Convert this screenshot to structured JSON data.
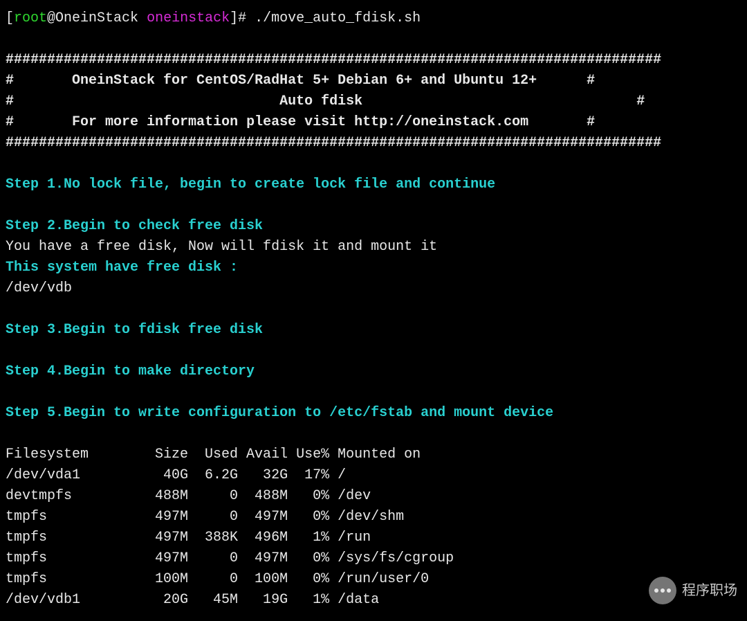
{
  "prompt": {
    "open": "[",
    "user": "root",
    "at": "@OneinStack ",
    "dir": "oneinstack",
    "close": "]# ",
    "command": "./move_auto_fdisk.sh"
  },
  "banner": {
    "hash_line": "###############################################################################",
    "pad": "       ",
    "line1": "OneinStack for CentOS/RadHat 5+ Debian 6+ and Ubuntu 12+",
    "pad1_after": "      ",
    "pad2_before": "                                ",
    "line2": "Auto fdisk",
    "pad2_after": "                                 ",
    "line3": "For more information please visit http://oneinstack.com",
    "pad3_after": "       "
  },
  "steps": {
    "s1": "Step 1.No lock file, begin to create lock file and continue",
    "s2": "Step 2.Begin to check free disk",
    "s2_msg": "You have a free disk, Now will fdisk it and mount it",
    "s2_info": "This system have free disk :",
    "s2_dev": "/dev/vdb",
    "s3": "Step 3.Begin to fdisk free disk",
    "s4": "Step 4.Begin to make directory",
    "s5": "Step 5.Begin to write configuration to /etc/fstab and mount device"
  },
  "df": {
    "header": [
      "Filesystem",
      "Size",
      "Used",
      "Avail",
      "Use%",
      "Mounted on"
    ],
    "rows": [
      [
        "/dev/vda1",
        "40G",
        "6.2G",
        "32G",
        "17%",
        "/"
      ],
      [
        "devtmpfs",
        "488M",
        "0",
        "488M",
        "0%",
        "/dev"
      ],
      [
        "tmpfs",
        "497M",
        "0",
        "497M",
        "0%",
        "/dev/shm"
      ],
      [
        "tmpfs",
        "497M",
        "388K",
        "496M",
        "1%",
        "/run"
      ],
      [
        "tmpfs",
        "497M",
        "0",
        "497M",
        "0%",
        "/sys/fs/cgroup"
      ],
      [
        "tmpfs",
        "100M",
        "0",
        "100M",
        "0%",
        "/run/user/0"
      ],
      [
        "/dev/vdb1",
        "20G",
        "45M",
        "19G",
        "1%",
        "/data"
      ]
    ]
  },
  "watermark": {
    "text": "程序职场"
  }
}
